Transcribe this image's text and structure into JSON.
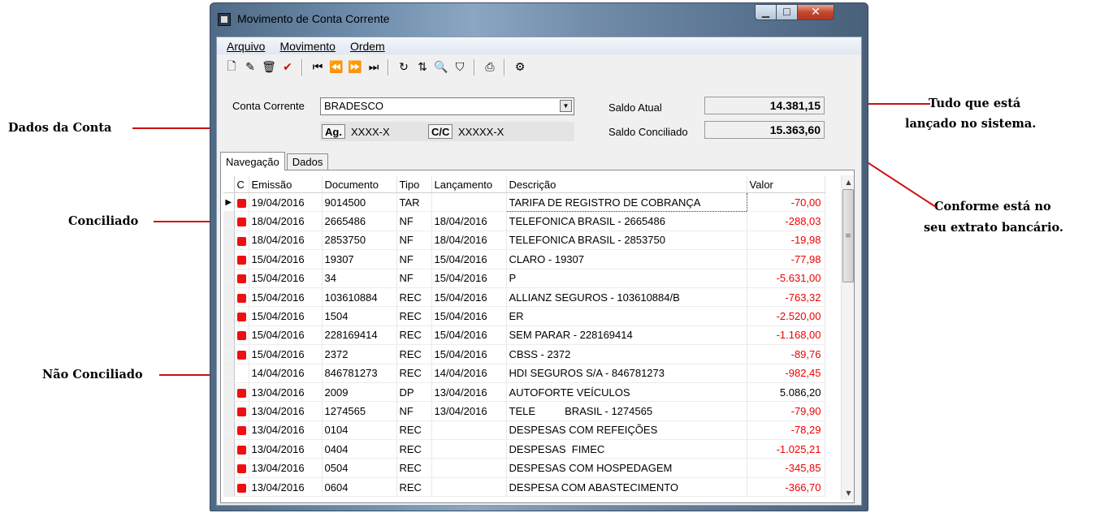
{
  "annotations": {
    "dados_da_conta": "Dados da Conta",
    "conciliado": "Conciliado",
    "nao_conciliado": "Não Conciliado",
    "tudo_line1": "Tudo que está",
    "tudo_line2": "lançado no sistema.",
    "conforme_line1": "Conforme está no",
    "conforme_line2": "seu extrato bancário.",
    "line_color": "#cc1010"
  },
  "window": {
    "title": "Movimento de Conta Corrente",
    "min_glyph": "▁",
    "max_glyph": "☐",
    "close_glyph": "✕"
  },
  "menu": {
    "arquivo": "Arquivo",
    "movimento": "Movimento",
    "ordem": "Ordem"
  },
  "toolbar": {
    "new": "🗋",
    "edit": "✎",
    "delete": "🗑",
    "confirm": "✔",
    "first": "⏮",
    "prev": "⏪",
    "next": "⏩",
    "last": "⏭",
    "refresh": "↻",
    "sort": "⇅",
    "find": "🔍",
    "filter": "⛉",
    "print": "⎙",
    "settings": "⚙"
  },
  "account": {
    "conta_label": "Conta Corrente",
    "conta_value": "BRADESCO",
    "ag_label": "Ag.",
    "ag_value": "XXXX-X",
    "cc_label": "C/C",
    "cc_value": "XXXXX-X"
  },
  "saldo": {
    "atual_label": "Saldo Atual",
    "atual_value": "14.381,15",
    "conciliado_label": "Saldo Conciliado",
    "conciliado_value": "15.363,60"
  },
  "tabs": {
    "navegacao": "Navegação",
    "dados": "Dados"
  },
  "grid": {
    "headers": {
      "c": "C",
      "emissao": "Emissão",
      "documento": "Documento",
      "tipo": "Tipo",
      "lancamento": "Lançamento",
      "descricao": "Descrição",
      "valor": "Valor"
    },
    "current_row_marker": "▶",
    "rows": [
      {
        "conciliado": true,
        "emissao": "19/04/2016",
        "documento": "9014500",
        "tipo": "TAR",
        "lancamento": "",
        "descricao": "TARIFA DE REGISTRO DE COBRANÇA",
        "valor": "-70,00"
      },
      {
        "conciliado": true,
        "emissao": "18/04/2016",
        "documento": "2665486",
        "tipo": "NF",
        "lancamento": "18/04/2016",
        "descricao": "TELEFONICA BRASIL - 2665486",
        "valor": "-288,03"
      },
      {
        "conciliado": true,
        "emissao": "18/04/2016",
        "documento": "2853750",
        "tipo": "NF",
        "lancamento": "18/04/2016",
        "descricao": "TELEFONICA BRASIL - 2853750",
        "valor": "-19,98"
      },
      {
        "conciliado": true,
        "emissao": "15/04/2016",
        "documento": "19307",
        "tipo": "NF",
        "lancamento": "15/04/2016",
        "descricao": "CLARO - 19307",
        "valor": "-77,98"
      },
      {
        "conciliado": true,
        "emissao": "15/04/2016",
        "documento": "34",
        "tipo": "NF",
        "lancamento": "15/04/2016",
        "descricao": "P",
        "valor": "-5.631,00"
      },
      {
        "conciliado": true,
        "emissao": "15/04/2016",
        "documento": "103610884",
        "tipo": "REC",
        "lancamento": "15/04/2016",
        "descricao": "ALLIANZ SEGUROS - 103610884/B",
        "valor": "-763,32"
      },
      {
        "conciliado": true,
        "emissao": "15/04/2016",
        "documento": "1504",
        "tipo": "REC",
        "lancamento": "15/04/2016",
        "descricao": "ER",
        "valor": "-2.520,00"
      },
      {
        "conciliado": true,
        "emissao": "15/04/2016",
        "documento": "228169414",
        "tipo": "REC",
        "lancamento": "15/04/2016",
        "descricao": "SEM PARAR - 228169414",
        "valor": "-1.168,00"
      },
      {
        "conciliado": true,
        "emissao": "15/04/2016",
        "documento": "2372",
        "tipo": "REC",
        "lancamento": "15/04/2016",
        "descricao": "CBSS - 2372",
        "valor": "-89,76"
      },
      {
        "conciliado": false,
        "emissao": "14/04/2016",
        "documento": "846781273",
        "tipo": "REC",
        "lancamento": "14/04/2016",
        "descricao": "HDI SEGUROS S/A - 846781273",
        "valor": "-982,45"
      },
      {
        "conciliado": true,
        "emissao": "13/04/2016",
        "documento": "2009",
        "tipo": "DP",
        "lancamento": "13/04/2016",
        "descricao": "AUTOFORTE VEÍCULOS",
        "valor": "5.086,20"
      },
      {
        "conciliado": true,
        "emissao": "13/04/2016",
        "documento": "1274565",
        "tipo": "NF",
        "lancamento": "13/04/2016",
        "descricao": "TELE          BRASIL - 1274565",
        "valor": "-79,90"
      },
      {
        "conciliado": true,
        "emissao": "13/04/2016",
        "documento": "0104",
        "tipo": "REC",
        "lancamento": "",
        "descricao": "DESPESAS COM REFEIÇÕES",
        "valor": "-78,29"
      },
      {
        "conciliado": true,
        "emissao": "13/04/2016",
        "documento": "0404",
        "tipo": "REC",
        "lancamento": "",
        "descricao": "DESPESAS  FIMEC",
        "valor": "-1.025,21"
      },
      {
        "conciliado": true,
        "emissao": "13/04/2016",
        "documento": "0504",
        "tipo": "REC",
        "lancamento": "",
        "descricao": "DESPESAS COM HOSPEDAGEM",
        "valor": "-345,85"
      },
      {
        "conciliado": true,
        "emissao": "13/04/2016",
        "documento": "0604",
        "tipo": "REC",
        "lancamento": "",
        "descricao": "DESPESA COM ABASTECIMENTO",
        "valor": "-366,70"
      }
    ],
    "conciliado_color": "#ee1010",
    "negative_color": "#ee0000"
  }
}
